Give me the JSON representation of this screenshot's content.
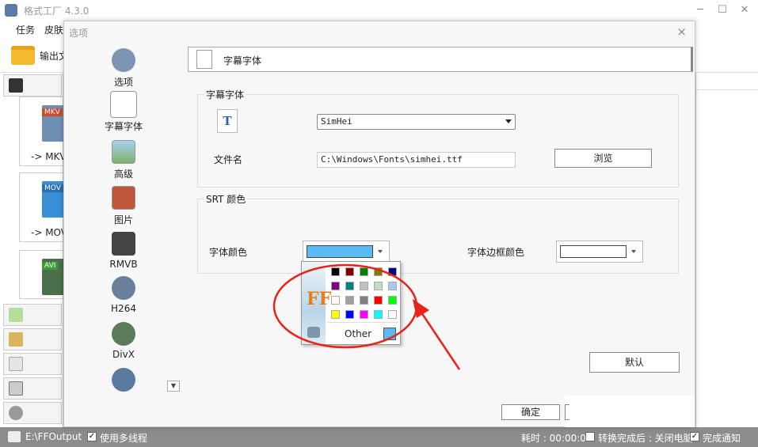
{
  "app": {
    "title": "格式工厂 4.3.0",
    "menu": [
      "任务",
      "皮肤"
    ],
    "toolbar_label": "输出文",
    "format_tiles": [
      {
        "tag": "MKV",
        "label": "-> MKV"
      },
      {
        "tag": "MOV",
        "label": "-> MOV"
      },
      {
        "tag": "AVI",
        "label": ""
      }
    ]
  },
  "dialog": {
    "title": "选项",
    "close_glyph": "×",
    "nav": [
      {
        "label": "选项"
      },
      {
        "label": "字幕字体"
      },
      {
        "label": "高级"
      },
      {
        "label": "图片"
      },
      {
        "label": "RMVB"
      },
      {
        "label": "H264"
      },
      {
        "label": "DivX"
      }
    ],
    "page_title": "字幕字体",
    "font_group": {
      "title": "字幕字体",
      "font_icon_glyph": "T",
      "font_value": "SimHei",
      "file_label": "文件名",
      "file_value": "C:\\Windows\\Fonts\\simhei.ttf",
      "browse_label": "浏览"
    },
    "srt_group": {
      "title": "SRT 颜色",
      "font_color_label": "字体颜色",
      "font_color": "#5bbcf5",
      "border_color_label": "字体边框颜色",
      "border_color": "#ffffff"
    },
    "palette": {
      "colors": [
        "#000000",
        "#800000",
        "#008000",
        "#808000",
        "#000080",
        "#800080",
        "#008080",
        "#c0c0c0",
        "#c0dcc0",
        "#a6caf0",
        "#fffbf0",
        "#a0a0a4",
        "#808080",
        "#ff0000",
        "#00ff00",
        "#ffff00",
        "#0000ff",
        "#ff00ff",
        "#00ffff",
        "#ffffff"
      ],
      "logo_text": "FF",
      "other_label": "Other",
      "other_color": "#5bbcf5"
    },
    "default_label": "默认",
    "ok_label": "确定"
  },
  "statusbar": {
    "path": "E:\\FFOutput",
    "multithread_label": "使用多线程",
    "elapsed": "耗时 : 00:00:00",
    "after_convert_label": "转换完成后 : 关闭电脑",
    "notify_label": "完成通知"
  },
  "annotation_color": "#e8231a"
}
